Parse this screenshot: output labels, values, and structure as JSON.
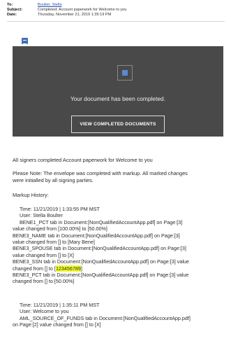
{
  "email": {
    "to_label": "To:",
    "to_value": "Boulter, Stella",
    "subject_label": "Subject:",
    "subject_value": "Completed: Account paperwork for Welcome to you",
    "date_label": "Date:",
    "date_value": "Thursday, November 21, 2019 1:35:19 PM"
  },
  "banner": {
    "message": "Your document has been completed.",
    "button_label": "VIEW COMPLETED DOCUMENTS"
  },
  "body": {
    "line1": "All signers completed Account paperwork for Welcome to you",
    "note_a": "Please Note: The envelope was completed with markup. All marked changes",
    "note_b": "were initialled by all signing parties.",
    "markup_history": "Markup History:"
  },
  "entries": [
    {
      "time": "Time: 11/21/2019 | 1:33:55 PM MST",
      "user": "User: Stella Boulter",
      "lines": [
        "BENE1_PCT tab in Document:[NonQualifiedAccountApp.pdf] on Page:[3]",
        "value changed from [100.00%] to [50.00%]",
        "BENE3_NAME tab in Document:[NonQualifiedAccountApp.pdf] on Page:[3]",
        "value changed from [] to [Mary Bene]",
        "BENE3_SPOUSE tab in Document:[NonQualifiedAccountApp.pdf] on Page:[3]",
        "value changed from [] to [X]",
        "BENE3_SSN tab in Document:[NonQualifiedAccountApp.pdf] on Page:[3] value",
        "changed from [] to [",
        "123456789",
        "]",
        "BENE3_PCT tab in Document:[NonQualifiedAccountApp.pdf] on Page:[3] value",
        "changed from [] to [50.00%]"
      ]
    },
    {
      "time": "Time: 11/21/2019 | 1:35:11 PM MST",
      "user": "User: Welcome to you",
      "lines": [
        "AML_SOURCE_OF_FUNDS tab in Document:[NonQualifiedAccountApp.pdf]",
        "on Page:[2] value changed from [] to [X]"
      ]
    }
  ]
}
